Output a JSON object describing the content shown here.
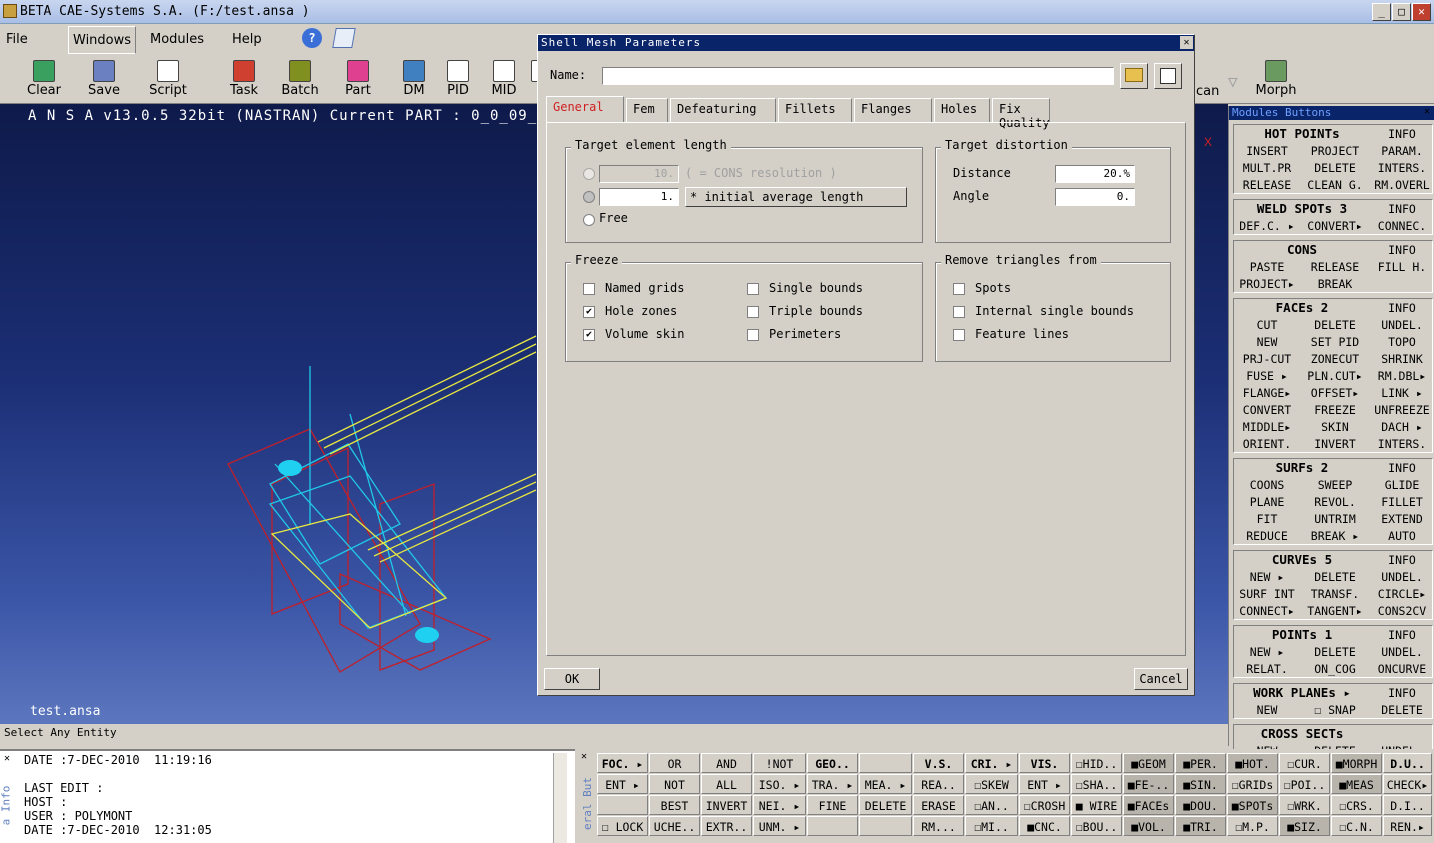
{
  "window": {
    "title": "BETA CAE-Systems S.A.  (F:/test.ansa )"
  },
  "menu": [
    "File",
    "Windows",
    "Modules",
    "Help"
  ],
  "toolbar": [
    {
      "label": "Clear",
      "icon": "clear-icon"
    },
    {
      "label": "Save",
      "icon": "save-icon"
    },
    {
      "label": "Script",
      "icon": "script-icon"
    },
    {
      "label": "Task",
      "icon": "task-icon"
    },
    {
      "label": "Batch",
      "icon": "batch-icon"
    },
    {
      "label": "Part",
      "icon": "part-icon"
    },
    {
      "label": "DM",
      "icon": "dm-icon"
    },
    {
      "label": "PID",
      "icon": "pid-icon"
    },
    {
      "label": "MID",
      "icon": "mid-icon"
    },
    {
      "label": "D",
      "icon": "d-icon"
    }
  ],
  "toolbar_right": [
    {
      "label": "can"
    },
    {
      "label": "Morph"
    }
  ],
  "viewport": {
    "info": "A N S A v13.0.5 32bit (NASTRAN)   Current PART : 0_0_09_0",
    "file": "test.ansa",
    "axis_marker": "X"
  },
  "status": "Select Any Entity",
  "infopane": {
    "side_label": "a Info",
    "text": "DATE :7-DEC-2010  11:19:16\n\nLAST EDIT :\nHOST :\nUSER : POLYMONT\nDATE :7-DEC-2010  12:31:05"
  },
  "dialog": {
    "title": "Shell Mesh Parameters",
    "close": "✕",
    "name_label": "Name:",
    "name_value": "",
    "tabs": [
      "General",
      "Fem",
      "Defeaturing",
      "Fillets",
      "Flanges",
      "Holes",
      "Fix Quality"
    ],
    "target_length": {
      "label": "Target element length",
      "cons_value": "10.",
      "cons_text": "( = CONS resolution )",
      "avg_value": "1.",
      "avg_text": "* initial average length",
      "free": "Free"
    },
    "target_distortion": {
      "label": "Target distortion",
      "distance_label": "Distance",
      "distance_value": "20.%",
      "angle_label": "Angle",
      "angle_value": "0."
    },
    "freeze": {
      "label": "Freeze",
      "items": [
        {
          "label": "Named grids",
          "checked": false
        },
        {
          "label": "Hole zones",
          "checked": true
        },
        {
          "label": "Volume skin",
          "checked": true
        },
        {
          "label": "Single bounds",
          "checked": false
        },
        {
          "label": "Triple bounds",
          "checked": false
        },
        {
          "label": "Perimeters",
          "checked": false
        }
      ]
    },
    "remove_triangles": {
      "label": "Remove triangles from",
      "items": [
        {
          "label": "Spots",
          "checked": false
        },
        {
          "label": "Internal single bounds",
          "checked": false
        },
        {
          "label": "Feature lines",
          "checked": false
        }
      ]
    },
    "ok": "OK",
    "cancel": "Cancel"
  },
  "modules": {
    "title": "Modules Buttons",
    "groups": [
      {
        "rows": [
          [
            "HOT POINTs",
            "",
            "INFO"
          ],
          [
            "INSERT",
            "PROJECT",
            "PARAM."
          ],
          [
            "MULT.PR",
            "DELETE",
            "INTERS."
          ],
          [
            "RELEASE",
            "CLEAN G.",
            "RM.OVERL"
          ]
        ]
      },
      {
        "rows": [
          [
            "WELD SPOTs 3",
            "",
            "INFO"
          ],
          [
            "DEF.C. ▸",
            "CONVERT▸",
            "CONNEC."
          ]
        ]
      },
      {
        "rows": [
          [
            "CONS",
            "",
            "INFO"
          ],
          [
            "PASTE",
            "RELEASE",
            "FILL H."
          ],
          [
            "PROJECT▸",
            "BREAK",
            ""
          ]
        ]
      },
      {
        "rows": [
          [
            "FACEs 2",
            "",
            "INFO"
          ],
          [
            "CUT",
            "DELETE",
            "UNDEL."
          ],
          [
            "NEW",
            "SET PID",
            "TOPO"
          ],
          [
            "PRJ-CUT",
            "ZONECUT",
            "SHRINK"
          ],
          [
            "FUSE ▸",
            "PLN.CUT▸",
            "RM.DBL▸"
          ],
          [
            "FLANGE▸",
            "OFFSET▸",
            "LINK ▸"
          ],
          [
            "CONVERT",
            "FREEZE",
            "UNFREEZE"
          ],
          [
            "MIDDLE▸",
            "SKIN",
            "DACH ▸"
          ],
          [
            "ORIENT.",
            "INVERT",
            "INTERS."
          ]
        ]
      },
      {
        "rows": [
          [
            "SURFs 2",
            "",
            "INFO"
          ],
          [
            "COONS",
            "SWEEP",
            "GLIDE"
          ],
          [
            "PLANE",
            "REVOL.",
            "FILLET"
          ],
          [
            "FIT",
            "UNTRIM",
            "EXTEND"
          ],
          [
            "REDUCE",
            "BREAK ▸",
            "AUTO"
          ]
        ]
      },
      {
        "rows": [
          [
            "CURVEs 5",
            "",
            "INFO"
          ],
          [
            "NEW ▸",
            "DELETE",
            "UNDEL."
          ],
          [
            "SURF INT",
            "TRANSF.",
            "CIRCLE▸"
          ],
          [
            "CONNECT▸",
            "TANGENT▸",
            "CONS2CV"
          ]
        ]
      },
      {
        "rows": [
          [
            "POINTs 1",
            "",
            "INFO"
          ],
          [
            "NEW ▸",
            "DELETE",
            "UNDEL."
          ],
          [
            "RELAT.",
            "ON_COG",
            "ONCURVE"
          ]
        ]
      },
      {
        "rows": [
          [
            "WORK PLANEs ▸",
            "",
            "INFO"
          ],
          [
            "NEW",
            "☐ SNAP",
            "DELETE"
          ]
        ]
      },
      {
        "rows": [
          [
            "CROSS SECTs",
            "",
            ""
          ],
          [
            "NEW",
            "DELETE",
            "UNDEL."
          ]
        ]
      }
    ]
  },
  "bottom": {
    "side_label": "eral But",
    "cols": [
      {
        "cells": [
          "FOC. ▸",
          "ENT ▸",
          "",
          "☐ LOCK"
        ]
      },
      {
        "cells": [
          "OR",
          "NOT",
          "BEST",
          "UCHE.."
        ]
      },
      {
        "cells": [
          "AND",
          "ALL",
          "INVERT",
          "EXTR.."
        ]
      },
      {
        "cells": [
          "!NOT",
          "ISO. ▸",
          "NEI. ▸",
          "UNM. ▸"
        ]
      },
      {
        "cells": [
          "GEO..",
          "TRA. ▸",
          "FINE",
          ""
        ]
      },
      {
        "cells": [
          "",
          "MEA. ▸",
          "DELETE",
          ""
        ]
      },
      {
        "cells": [
          "V.S.",
          "REA..",
          "ERASE",
          "RM..."
        ]
      },
      {
        "cells": [
          "CRI. ▸",
          "☐SKEW",
          "☐AN..",
          "☐MI.."
        ]
      },
      {
        "cells": [
          "VIS.",
          "ENT ▸",
          "☐CROSH",
          "■CNC."
        ]
      },
      {
        "cells": [
          "☐HID..",
          "☐SHA..",
          "■ WIRE",
          "☐BOU.."
        ]
      },
      {
        "cells": [
          "■GEOM",
          "■FE-..",
          "■FACEs",
          "■VOL."
        ]
      },
      {
        "cells": [
          "■PER.",
          "■SIN.",
          "■DOU.",
          "■TRI."
        ]
      },
      {
        "cells": [
          "■HOT.",
          "☐GRIDs",
          "■SPOTs",
          "☐M.P."
        ]
      },
      {
        "cells": [
          "☐CUR.",
          "☐POI..",
          "☐WRK.",
          "■SIZ."
        ]
      },
      {
        "cells": [
          "■MORPH",
          "■MEAS",
          "☐CRS.",
          "☐C.N."
        ]
      },
      {
        "cells": [
          "D.U..",
          "CHECK▸",
          "D.I..",
          "REN.▸"
        ]
      }
    ]
  }
}
